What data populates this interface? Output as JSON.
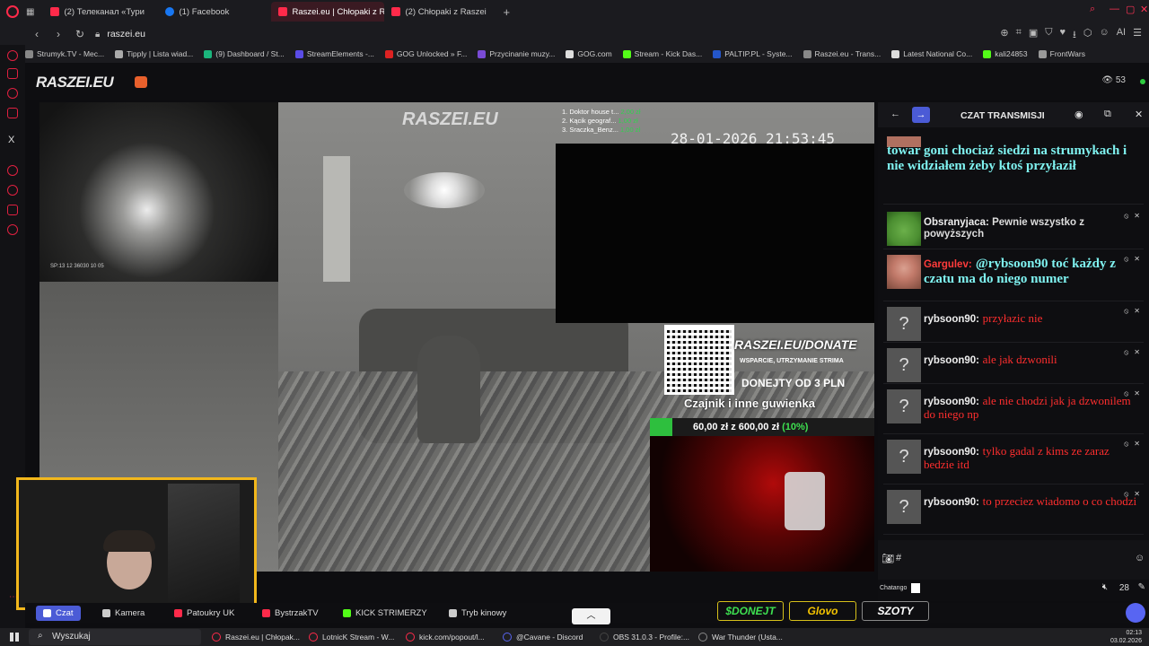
{
  "browser": {
    "tabs": [
      {
        "label": "(2) Телеканал «Тури",
        "active": false,
        "color": "#ff2a4a"
      },
      {
        "label": "(1) Facebook",
        "active": false,
        "color": "#1877f2"
      },
      {
        "label": "Raszei.eu | Chłopaki z Ra",
        "active": true,
        "color": "#ff2a4a"
      },
      {
        "label": "(2) Chłopaki z Raszei",
        "active": false,
        "color": "#ff2a4a"
      }
    ],
    "url": "raszei.eu",
    "bookmarks": [
      {
        "label": "Strumyk.TV - Mec...",
        "color": "#888"
      },
      {
        "label": "Tipply | Lista wiad...",
        "color": "#aaa"
      },
      {
        "label": "(9) Dashboard / St...",
        "color": "#1bb57c"
      },
      {
        "label": "StreamElements -...",
        "color": "#5a4ce6"
      },
      {
        "label": "GOG Unlocked » F...",
        "color": "#d22"
      },
      {
        "label": "Przycinanie muzy...",
        "color": "#7a4bd6"
      },
      {
        "label": "GOG.com",
        "color": "#ddd"
      },
      {
        "label": "Stream - Kick Das...",
        "color": "#53fc18"
      },
      {
        "label": "PALTIP.PL - Syste...",
        "color": "#2456c9"
      },
      {
        "label": "Raszei.eu - Trans...",
        "color": "#888"
      },
      {
        "label": "Latest National Co...",
        "color": "#ddd"
      },
      {
        "label": "kali24853",
        "color": "#53fc18"
      },
      {
        "label": "FrontWars",
        "color": "#999"
      }
    ]
  },
  "site": {
    "logo": "RASZEI.EU",
    "viewers": "53"
  },
  "overlay": {
    "watermark": "RASZEI.EU",
    "timestamp": "28-01-2026 21:53:45",
    "left_cam_timestamp": "SP:13 12 36030 10 05",
    "top_donors": [
      {
        "name": "1. Doktor house t...",
        "amount": "2,00 zł"
      },
      {
        "name": "2. Kącik geograf...",
        "amount": "1,00 zł"
      },
      {
        "name": "3. Sraczka_Benz...",
        "amount": "1,00 zł"
      }
    ],
    "donate_url": "RASZEI.EU/DONATE",
    "donate_sub": "WSPARCIE, UTRZYMANIE STRIMA",
    "donate_min": "DONEJTY OD 3 PLN",
    "goal_title": "Czajnik i inne guwienka",
    "goal_amount": "60,00 zł z 600,00 zł",
    "goal_percent_label": "(10%)",
    "goal_fraction": 0.1
  },
  "stream_bar": {
    "buttons": [
      {
        "label": "Czat",
        "active": true
      },
      {
        "label": "Kamera",
        "active": false
      },
      {
        "label": "Patoukry UK",
        "active": false
      },
      {
        "label": "BystrzakTV",
        "active": false
      },
      {
        "label": "KICK STRIMERZY",
        "active": false
      },
      {
        "label": "Tryb kinowy",
        "active": false
      }
    ],
    "sponsors": [
      "$DONEJT",
      "Glovo",
      "SZOTY"
    ]
  },
  "chat": {
    "title": "CZAT TRANSMISJI",
    "messages": [
      {
        "user": "",
        "text": "towar goni chociaż siedzi na strumykach i nie widziałem żeby ktoś przyłaził",
        "style": "cyan",
        "avatar": "partial"
      },
      {
        "user": "Obsranyjaca:",
        "text": "Pewnie wszystko z powyższych",
        "style": "white",
        "avatar": "pepe"
      },
      {
        "user": "Gargulev:",
        "text": "@rybsoon90 toć każdy z czatu ma do niego numer",
        "style": "cyan",
        "avatar": "garg"
      },
      {
        "user": "rybsoon90:",
        "text": "przyłazic nie",
        "style": "red",
        "avatar": "?"
      },
      {
        "user": "rybsoon90:",
        "text": "ale jak dzwonili",
        "style": "red",
        "avatar": "?"
      },
      {
        "user": "rybsoon90:",
        "text": "ale nie chodzi jak ja dzwonilem do niego np",
        "style": "red",
        "avatar": "?"
      },
      {
        "user": "rybsoon90:",
        "text": "tylko gadal z kims ze zaraz bedzie itd",
        "style": "red",
        "avatar": "?"
      },
      {
        "user": "rybsoon90:",
        "text": "to przeciez wiadomo o co chodzi",
        "style": "red",
        "avatar": "?"
      }
    ],
    "input_hash": "#",
    "footer_label": "Chatango",
    "user_count": "28"
  },
  "taskbar": {
    "search": "Wyszukaj",
    "items": [
      {
        "label": "Raszei.eu | Chłopak...",
        "color": "#ff2a4a"
      },
      {
        "label": "LotnicK Stream - W...",
        "color": "#ff2a4a"
      },
      {
        "label": "kick.com/popout/l...",
        "color": "#ff2a4a"
      },
      {
        "label": "@Cavane - Discord",
        "color": "#5865f2"
      },
      {
        "label": "OBS 31.0.3 - Profile:...",
        "color": "#444"
      },
      {
        "label": "War Thunder (Usta...",
        "color": "#888"
      }
    ],
    "time": "02:13",
    "date": "03.02.2026"
  }
}
